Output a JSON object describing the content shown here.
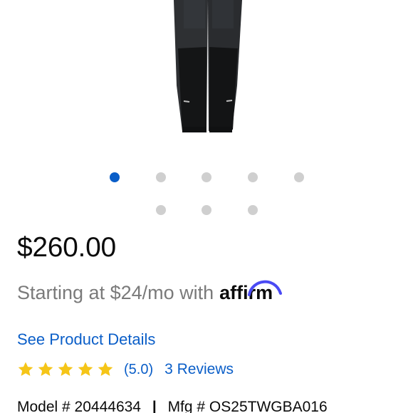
{
  "product": {
    "image_icon": "pants-product-image",
    "carousel": {
      "total": 8,
      "active_index": 0
    },
    "price": "$260.00",
    "financing": {
      "text": "Starting at $24/mo with",
      "brand": "affirm"
    },
    "details_link": "See Product Details",
    "rating": {
      "stars": 5,
      "value_label": "(5.0)",
      "reviews_label": "3 Reviews",
      "star_color": "#f5c518"
    },
    "model": {
      "model_label": "Model # 20444634",
      "separator": "|",
      "mfg_label": "Mfg # OS25TWGBA016"
    }
  },
  "colors": {
    "accent": "#0a5ec8",
    "price_text": "#0b0b0b",
    "muted_text": "#7a7a7a",
    "dot_inactive": "#cfcfcf"
  }
}
